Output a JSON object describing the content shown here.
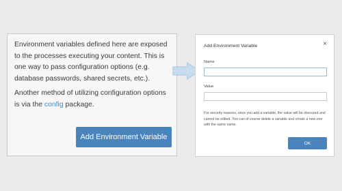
{
  "info_panel": {
    "paragraph_1": "Environment variables defined here are exposed to the processes executing your content. This is one way to pass configuration options (e.g. database passwords, shared secrets, etc.).",
    "paragraph_2_prefix": "Another method of utilizing configuration options is via the ",
    "paragraph_2_link": "config",
    "paragraph_2_suffix": " package.",
    "add_button_label": "Add Environment Variable"
  },
  "dialog": {
    "title": "Add Environment Variable",
    "close_icon": "×",
    "name_label": "Name",
    "name_value": "",
    "value_label": "Value",
    "value_value": "",
    "notice": "For security reasons, once you add a variable, the value will be obscured and cannot be edited. You can of course delete a variable and create a new one with the same name.",
    "ok_label": "OK"
  },
  "colors": {
    "accent": "#4a84bc",
    "link": "#3f8ad0",
    "arrow": "#c9dcef"
  }
}
